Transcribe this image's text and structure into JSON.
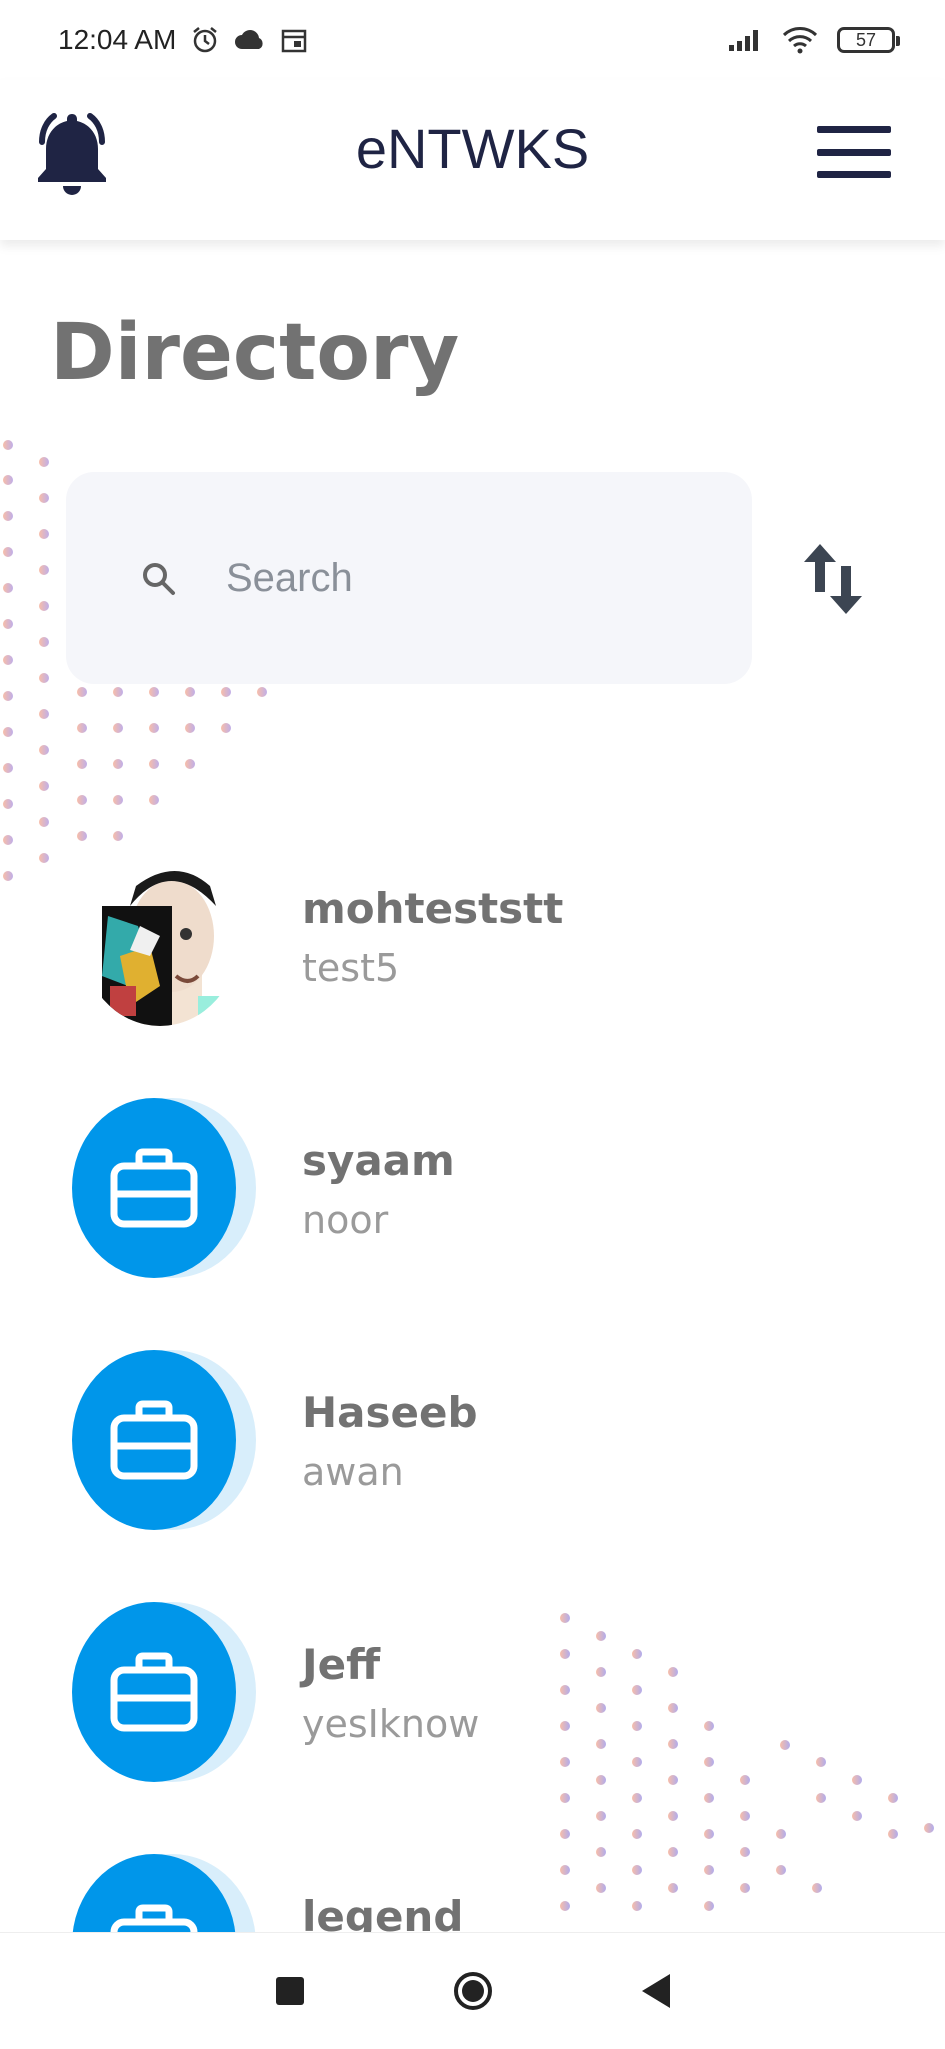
{
  "status_bar": {
    "time": "12:04 AM",
    "battery": "57",
    "icons": [
      "alarm-icon",
      "cloud-icon",
      "calendar-icon",
      "signal-icon",
      "wifi-icon",
      "battery-icon"
    ]
  },
  "header": {
    "title": "eNTWKS",
    "left_icon": "bell-icon",
    "right_icon": "menu-icon"
  },
  "page": {
    "title": "Directory"
  },
  "search": {
    "placeholder": "Search",
    "value": ""
  },
  "sort_icon": "sort-arrows-icon",
  "contacts": [
    {
      "name": "mohteststt",
      "subtitle": "test5",
      "avatar": "photo"
    },
    {
      "name": "syaam",
      "subtitle": "noor",
      "avatar": "briefcase-icon"
    },
    {
      "name": "Haseeb",
      "subtitle": "awan",
      "avatar": "briefcase-icon"
    },
    {
      "name": "Jeff",
      "subtitle": "yesIknow",
      "avatar": "briefcase-icon"
    },
    {
      "name": "legend",
      "subtitle": "",
      "avatar": "briefcase-icon"
    }
  ],
  "colors": {
    "accent": "#0096ea",
    "title": "#1f2444",
    "text_gray": "#727272"
  },
  "navbar": {
    "buttons": [
      "recent-apps-button",
      "home-button",
      "back-button"
    ]
  }
}
